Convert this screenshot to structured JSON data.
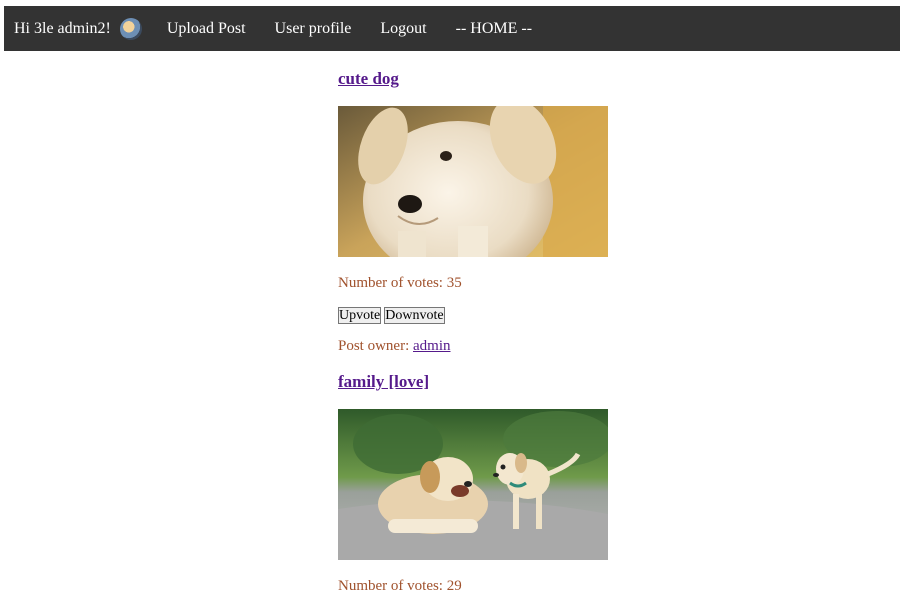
{
  "nav": {
    "greeting": "Hi 3le admin2!",
    "links": [
      "Upload Post",
      "User profile",
      "Logout",
      "-- HOME --"
    ]
  },
  "posts": [
    {
      "title": "cute dog",
      "image_icon": "puppy-photo",
      "votes_label": "Number of votes: 35",
      "upvote_label": "Upvote",
      "downvote_label": "Downvote",
      "owner_prefix": "Post owner: ",
      "owner_name": "admin"
    },
    {
      "title": "family [love]",
      "image_icon": "dogs-family-photo",
      "votes_label": "Number of votes: 29"
    }
  ],
  "colors": {
    "navbar_bg": "#333333",
    "link_visited": "#551a8b",
    "meta_text": "#a0522d"
  }
}
